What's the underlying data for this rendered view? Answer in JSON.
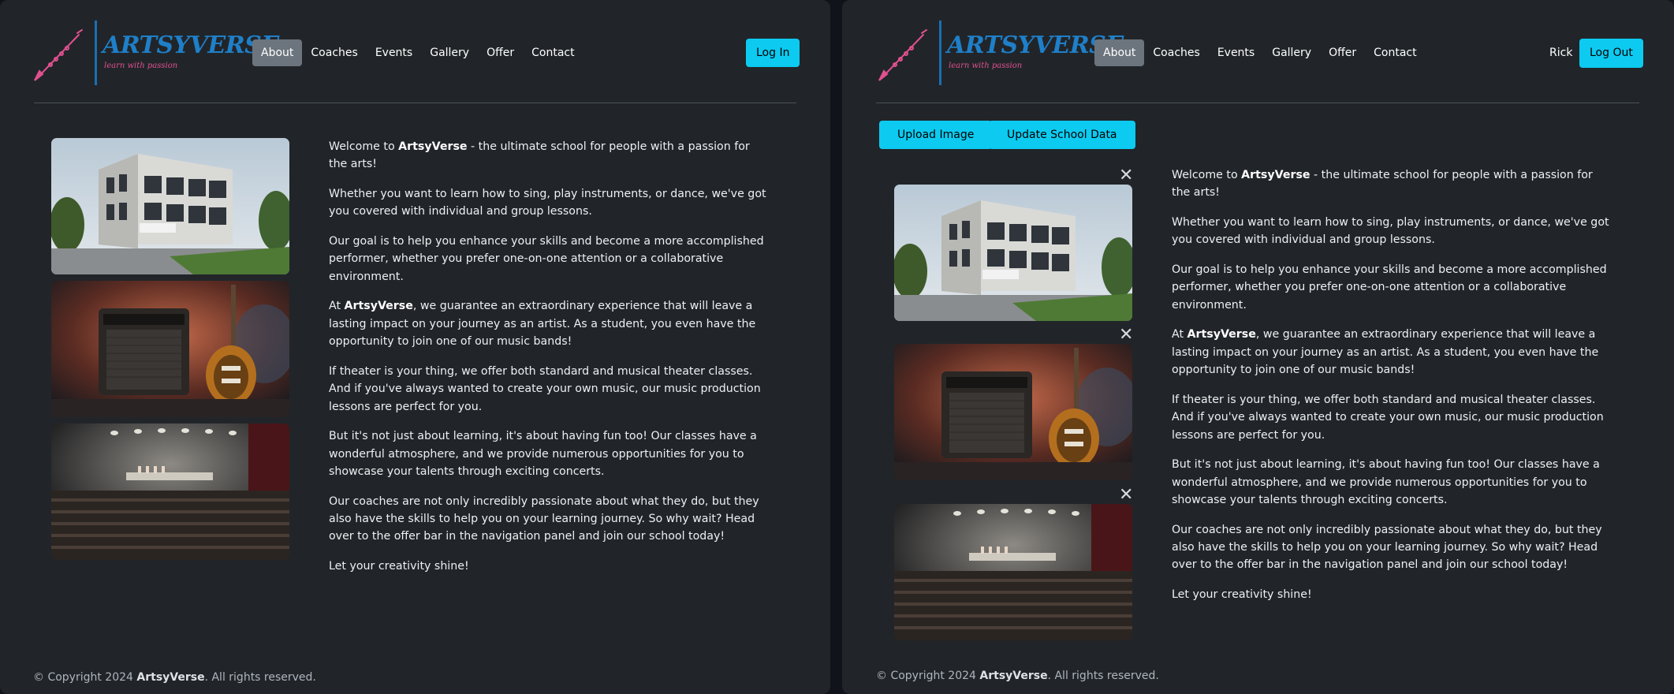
{
  "brand": {
    "name": "ARTSYVERSE",
    "tagline": "learn with passion"
  },
  "nav": [
    "About",
    "Coaches",
    "Events",
    "Gallery",
    "Offer",
    "Contact"
  ],
  "left": {
    "login_label": "Log In"
  },
  "right": {
    "user_name": "Rick",
    "logout_label": "Log Out",
    "upload_label": "Upload Image",
    "update_label": "Update School Data",
    "close_glyph": "✕"
  },
  "content": {
    "p1_pre": "Welcome to ",
    "brand_bold": "ArtsyVerse",
    "p1_post": " - the ultimate school for people with a passion for the arts!",
    "p2": "Whether you want to learn how to sing, play instruments, or dance, we've got you covered with individual and group lessons.",
    "p3": "Our goal is to help you enhance your skills and become a more accomplished performer, whether you prefer one-on-one attention or a collaborative environment.",
    "p4_pre": "At ",
    "p4_post": ", we guarantee an extraordinary experience that will leave a lasting impact on your journey as an artist. As a student, you even have the opportunity to join one of our music bands!",
    "p5": "If theater is your thing, we offer both standard and musical theater classes. And if you've always wanted to create your own music, our music production lessons are perfect for you.",
    "p6": "But it's not just about learning, it's about having fun too! Our classes have a wonderful atmosphere, and we provide numerous opportunities for you to showcase your talents through exciting concerts.",
    "p7": "Our coaches are not only incredibly passionate about what they do, but they also have the skills to help you on your learning journey. So why wait? Head over to the offer bar in the navigation panel and join our school today!",
    "p8": "Let your creativity shine!"
  },
  "footer": {
    "pre": "© Copyright 2024 ",
    "brand": "ArtsyVerse",
    "post": ". All rights reserved."
  },
  "images": [
    "school-building-image",
    "amp-and-guitar-image",
    "theater-stage-image"
  ],
  "colors": {
    "accent": "#0dcaf0",
    "background": "#212529",
    "nav_active": "#6c757d",
    "brand_blue": "#1f7fc8",
    "brand_pink": "#e0508f"
  }
}
